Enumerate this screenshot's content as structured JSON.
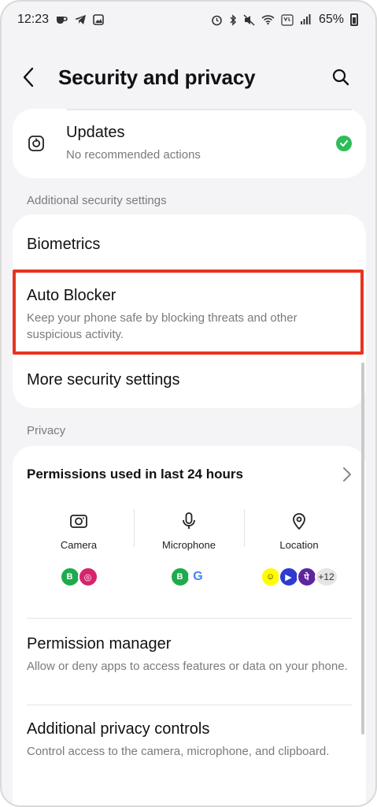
{
  "status_bar": {
    "time": "12:23",
    "battery_pct": "65%"
  },
  "header": {
    "title": "Security and privacy"
  },
  "updates": {
    "title": "Updates",
    "subtitle": "No recommended actions"
  },
  "additional_security": {
    "section_label": "Additional security settings",
    "biometrics": "Biometrics",
    "auto_blocker_title": "Auto Blocker",
    "auto_blocker_sub": "Keep your phone safe by blocking threats and other suspicious activity.",
    "more_settings": "More security settings"
  },
  "privacy": {
    "section_label": "Privacy",
    "permissions_title": "Permissions used in last 24 hours",
    "columns": [
      {
        "label": "Camera",
        "icon": "camera-icon"
      },
      {
        "label": "Microphone",
        "icon": "microphone-icon"
      },
      {
        "label": "Location",
        "icon": "location-icon"
      }
    ],
    "more_apps": "+12",
    "permission_manager_title": "Permission manager",
    "permission_manager_sub": "Allow or deny apps to access features or data on your phone.",
    "additional_controls_title": "Additional privacy controls",
    "additional_controls_sub": "Control access to the camera, microphone, and clipboard."
  },
  "colors": {
    "accent_highlight": "#e8331f",
    "check_green": "#2ebd59",
    "background": "#f4f4f6"
  }
}
